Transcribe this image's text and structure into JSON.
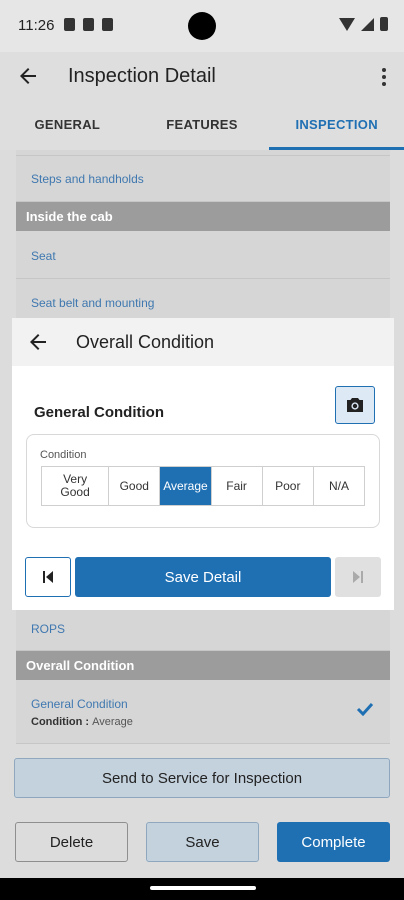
{
  "status_bar": {
    "time": "11:26"
  },
  "app_bar": {
    "title": "Inspection Detail"
  },
  "tabs": [
    {
      "label": "GENERAL",
      "active": false
    },
    {
      "label": "FEATURES",
      "active": false
    },
    {
      "label": "INSPECTION",
      "active": true
    }
  ],
  "list_top": {
    "item_steps": "Steps and handholds",
    "section_cab": "Inside the cab",
    "item_seat": "Seat",
    "item_seatbelt": "Seat belt and mounting"
  },
  "dialog": {
    "title": "Overall Condition",
    "field_title": "General Condition",
    "condition_label": "Condition",
    "options": [
      "Very Good",
      "Good",
      "Average",
      "Fair",
      "Poor",
      "N/A"
    ],
    "selected": "Average",
    "save_label": "Save Detail"
  },
  "list_bottom": {
    "item_rops": "ROPS",
    "section_overall": "Overall Condition",
    "gc_title": "General Condition",
    "gc_condition_key": "Condition",
    "gc_condition_value": "Average"
  },
  "buttons": {
    "send": "Send to Service for Inspection",
    "delete": "Delete",
    "save": "Save",
    "complete": "Complete"
  },
  "colors": {
    "accent": "#1f6fb3",
    "section_bg": "#9c9c9c"
  }
}
